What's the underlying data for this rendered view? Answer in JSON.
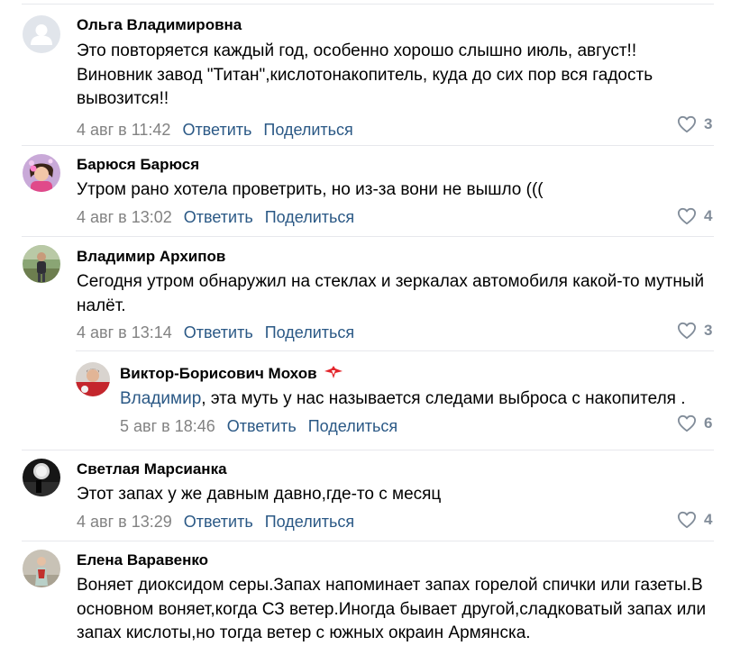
{
  "comments": [
    {
      "author": "Ольга Владимировна",
      "text": "Это повторяется каждый год, особенно хорошо слышно июль, август!! Виновник завод \"Титан\",кислотонакопитель, куда до сих пор вся гадость вывозится!!",
      "date": "4 авг в 11:42",
      "reply_label": "Ответить",
      "share_label": "Поделиться",
      "likes": "3"
    },
    {
      "author": "Барюся Барюся",
      "text": "Утром рано хотела проветрить, но из-за вони не вышло (((",
      "date": "4 авг в 13:02",
      "reply_label": "Ответить",
      "share_label": "Поделиться",
      "likes": "4"
    },
    {
      "author": "Владимир Архипов",
      "text": "Сегодня утром обнаружил на стеклах и зеркалах автомобиля какой-то мутный налёт.",
      "date": "4 авг в 13:14",
      "reply_label": "Ответить",
      "share_label": "Поделиться",
      "likes": "3"
    },
    {
      "author": "Виктор-Борисович Мохов",
      "mention": "Владимир",
      "text": ", эта муть у нас называется следами выброса с накопителя .",
      "date": "5 авг в 18:46",
      "reply_label": "Ответить",
      "share_label": "Поделиться",
      "likes": "6"
    },
    {
      "author": "Светлая Марсианка",
      "text": "Этот запах у же давным давно,где-то с месяц",
      "date": "4 авг в 13:29",
      "reply_label": "Ответить",
      "share_label": "Поделиться",
      "likes": "4"
    },
    {
      "author": "Елена Варавенко",
      "text": "Воняет диоксидом серы.Запах напоминает запах горелой спички или газеты.В основном воняет,когда СЗ ветер.Иногда бывает другой,сладковатый запах или запах кислоты,но тогда ветер с южных окраин Армянска."
    }
  ],
  "icons": {
    "like": "heart-outline-icon",
    "badge": "spartak-emblem-icon",
    "default_avatar": "user-silhouette-icon"
  },
  "colors": {
    "link": "#2a5885",
    "meta": "#828282",
    "like_count": "#818c99",
    "divider": "#e7e8ec",
    "badge_red": "#e3262c"
  }
}
